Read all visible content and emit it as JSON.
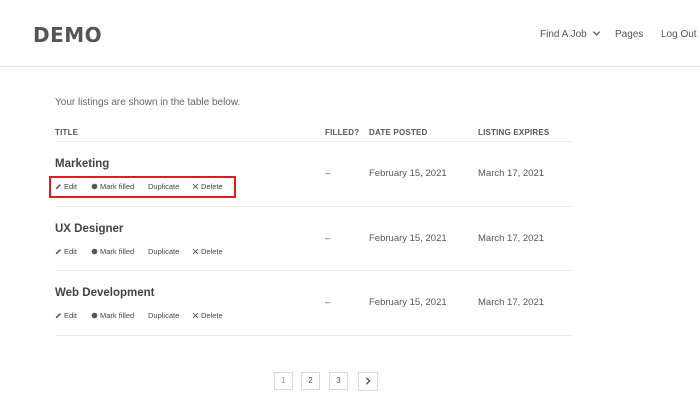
{
  "header": {
    "logo": "DEMO",
    "nav": {
      "find_job": "Find A Job",
      "pages": "Pages",
      "logout": "Log Out"
    }
  },
  "intro": "Your listings are shown in the table below.",
  "table": {
    "columns": {
      "title": "TITLE",
      "filled": "FILLED?",
      "date_posted": "DATE POSTED",
      "listing_expires": "LISTING EXPIRES"
    },
    "actions": {
      "edit": "Edit",
      "mark_filled": "Mark filled",
      "duplicate": "Duplicate",
      "delete": "Delete"
    },
    "rows": [
      {
        "title": "Marketing",
        "filled": "–",
        "date_posted": "February 15, 2021",
        "expires": "March 17, 2021"
      },
      {
        "title": "UX Designer",
        "filled": "–",
        "date_posted": "February 15, 2021",
        "expires": "March 17, 2021"
      },
      {
        "title": "Web Development",
        "filled": "–",
        "date_posted": "February 15, 2021",
        "expires": "March 17, 2021"
      }
    ]
  },
  "pagination": {
    "pages": [
      "1",
      "2",
      "3"
    ],
    "current": "1",
    "next_icon": "chevron-right-icon"
  },
  "colors": {
    "highlight": "#e01b24",
    "active_page": "#7fb04a"
  }
}
